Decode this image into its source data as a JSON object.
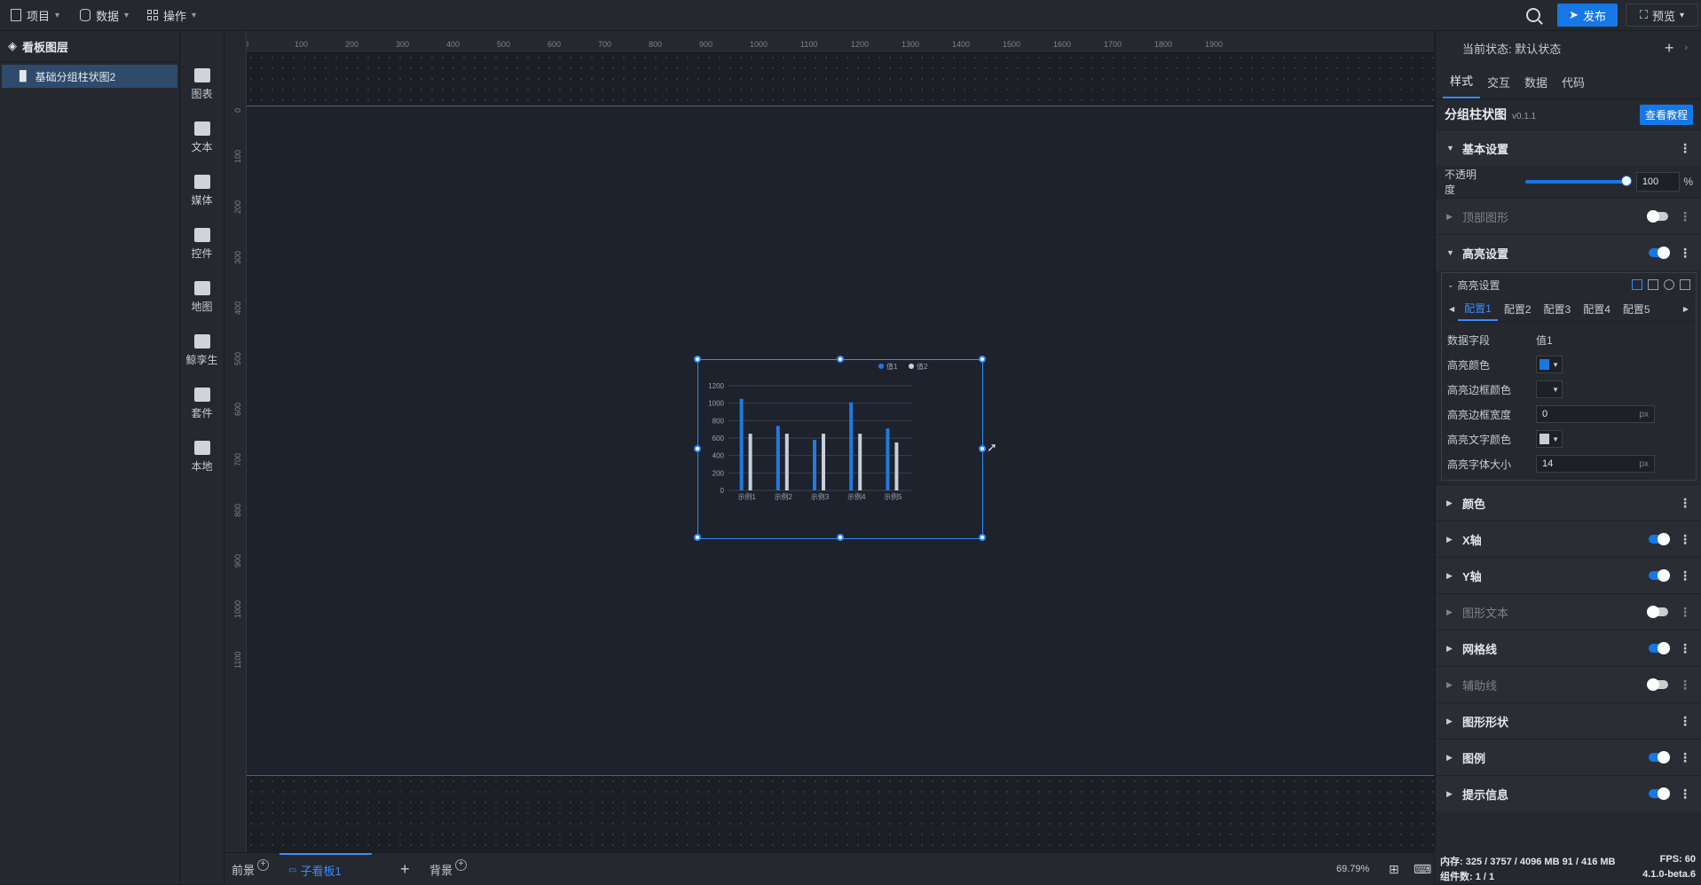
{
  "topbar": {
    "menus": [
      {
        "label": "项目"
      },
      {
        "label": "数据"
      },
      {
        "label": "操作"
      }
    ],
    "publish_label": "发布",
    "preview_label": "预览"
  },
  "layers": {
    "title": "看板图层",
    "items": [
      {
        "label": "基础分组柱状图2"
      }
    ]
  },
  "components": [
    {
      "label": "图表",
      "icon": "chart-icon"
    },
    {
      "label": "文本",
      "icon": "text-icon"
    },
    {
      "label": "媒体",
      "icon": "media-icon"
    },
    {
      "label": "控件",
      "icon": "control-icon"
    },
    {
      "label": "地图",
      "icon": "map-icon"
    },
    {
      "label": "鲸孪生",
      "icon": "twin-icon"
    },
    {
      "label": "套件",
      "icon": "kit-icon"
    },
    {
      "label": "本地",
      "icon": "local-icon"
    }
  ],
  "ruler": {
    "top": [
      "0",
      "100",
      "200",
      "300",
      "400",
      "500",
      "600",
      "700",
      "800",
      "900",
      "1000",
      "1100",
      "1200",
      "1300",
      "1400",
      "1500",
      "1600",
      "1700",
      "1800",
      "1900"
    ],
    "left": [
      "0",
      "100",
      "200",
      "300",
      "400",
      "500",
      "600",
      "700",
      "800",
      "900",
      "1000",
      "1100"
    ]
  },
  "chart_data": {
    "type": "bar",
    "categories": [
      "示例1",
      "示例2",
      "示例3",
      "示例4",
      "示例5"
    ],
    "series": [
      {
        "name": "值1",
        "values": [
          1050,
          740,
          580,
          1010,
          710
        ],
        "color": "#1f7be0"
      },
      {
        "name": "值2",
        "values": [
          650,
          650,
          650,
          650,
          550
        ],
        "color": "#c6cfdc"
      }
    ],
    "yticks": [
      "0",
      "200",
      "400",
      "600",
      "800",
      "1000",
      "1200"
    ],
    "ylim": [
      0,
      1200
    ],
    "legend_position": "top-right",
    "grid": true
  },
  "bottombar": {
    "tabs": [
      {
        "label": "前景"
      },
      {
        "label": "子看板1"
      },
      {
        "label": "背景"
      }
    ],
    "zoom": "69.79%"
  },
  "rightpanel": {
    "state_label": "当前状态: 默认状态",
    "tabs": [
      "样式",
      "交互",
      "数据",
      "代码"
    ],
    "component_name": "分组柱状图",
    "version": "v0.1.1",
    "tutorial_label": "查看教程",
    "basic_section": "基本设置",
    "opacity_label": "不透明度",
    "opacity_value": "100",
    "opacity_unit": "%",
    "opacity_level": 100,
    "top_shape_label": "顶部图形",
    "highlight_section": "高亮设置",
    "highlight_sub_title": "高亮设置",
    "config_tabs": [
      "配置1",
      "配置2",
      "配置3",
      "配置4",
      "配置5"
    ],
    "fields": {
      "data_field_label": "数据字段",
      "data_field_value": "值1",
      "hl_color_label": "高亮颜色",
      "hl_color": "#1677e6",
      "hl_border_color_label": "高亮边框颜色",
      "hl_border_width_label": "高亮边框宽度",
      "hl_border_width_value": "0",
      "hl_text_color_label": "高亮文字颜色",
      "hl_text_color": "#c9ccd2",
      "hl_font_size_label": "高亮字体大小",
      "hl_font_size_value": "14",
      "unit_px": "px"
    },
    "sections": [
      {
        "label": "颜色",
        "toggle": null,
        "dim": false
      },
      {
        "label": "X轴",
        "toggle": "on",
        "dim": false
      },
      {
        "label": "Y轴",
        "toggle": "on",
        "dim": false
      },
      {
        "label": "图形文本",
        "toggle": "off",
        "dim": true
      },
      {
        "label": "网格线",
        "toggle": "on",
        "dim": false
      },
      {
        "label": "辅助线",
        "toggle": "off",
        "dim": true
      },
      {
        "label": "图形形状",
        "toggle": null,
        "dim": false
      },
      {
        "label": "图例",
        "toggle": "on",
        "dim": false
      },
      {
        "label": "提示信息",
        "toggle": "on",
        "dim": false
      }
    ]
  },
  "status": {
    "memory": "内存: 325 / 3757 / 4096 MB  91 / 416 MB",
    "fps": "FPS: 60",
    "components": "组件数: 1 / 1",
    "version": "4.1.0-beta.6"
  }
}
